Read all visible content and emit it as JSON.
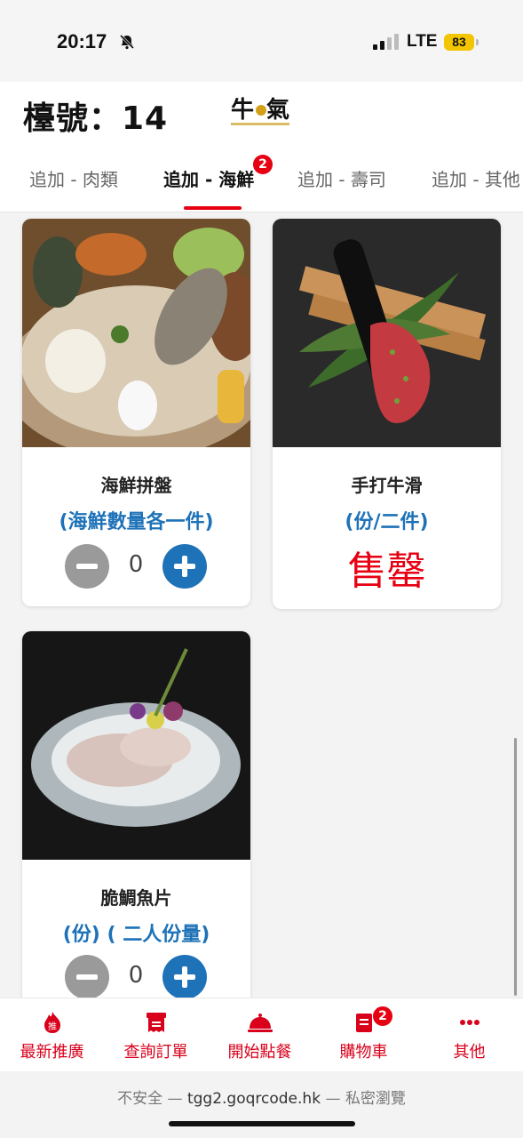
{
  "status_bar": {
    "time": "20:17",
    "network": "LTE",
    "battery": "83"
  },
  "header": {
    "table_label": "檯號：14",
    "tabs": [
      {
        "label": "追加 - 肉類"
      },
      {
        "label": "追加 - 海鮮",
        "badge": "2"
      },
      {
        "label": "追加 - 壽司"
      },
      {
        "label": "追加 - 其他"
      }
    ]
  },
  "products": [
    {
      "name": "海鮮拼盤",
      "note": "(海鮮數量各一件)",
      "quantity": "0"
    },
    {
      "name": "手打牛滑",
      "note": "(份/二件)",
      "status": "售罄"
    },
    {
      "name": "脆鯛魚片",
      "note": "(份) ( 二人份量)",
      "quantity": "0"
    }
  ],
  "bottom_nav": [
    {
      "label": "最新推廣",
      "icon": "fire-icon",
      "icon_text": "推"
    },
    {
      "label": "查詢訂單",
      "icon": "receipt-icon"
    },
    {
      "label": "開始點餐",
      "icon": "cloche-icon"
    },
    {
      "label": "購物車",
      "icon": "cart-icon",
      "badge": "2"
    },
    {
      "label": "其他",
      "icon": "more-icon",
      "icon_text": "•••"
    }
  ],
  "browser": {
    "security": "不安全 — ",
    "domain": "tgg2.goqrcode.hk",
    "mode": " — 私密瀏覽"
  },
  "colors": {
    "accent_red": "#e60012",
    "blue": "#1e72b8",
    "grey_button": "#9a9a9a"
  }
}
